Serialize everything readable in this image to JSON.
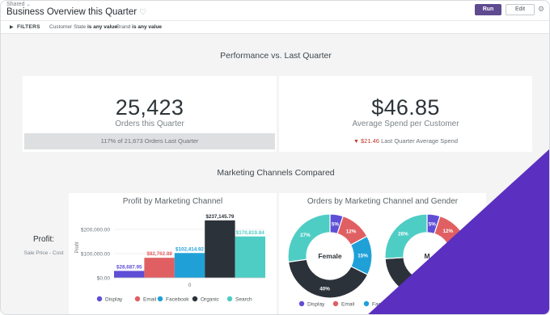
{
  "header": {
    "shared_label": "Shared",
    "title": "Business Overview this Quarter",
    "run_label": "Run",
    "edit_label": "Edit"
  },
  "filters": {
    "label": "FILTERS",
    "items": [
      {
        "name": "Customer State",
        "text": "is any value"
      },
      {
        "name": "Brand",
        "text": "is any value"
      }
    ]
  },
  "sections": {
    "performance": "Performance vs. Last Quarter",
    "channels": "Marketing Channels Compared"
  },
  "kpis": [
    {
      "value": "25,423",
      "label": "Orders this Quarter",
      "foot_pct": "117%",
      "foot_of": "of",
      "foot_value": "21,673",
      "foot_text": "Orders Last Quarter"
    },
    {
      "value": "$46.85",
      "label": "Average Spend per Customer",
      "foot_arrow": "▼",
      "foot_value": "$21.46",
      "foot_text": "Last Quarter Average Spend"
    }
  ],
  "side_label": {
    "title": "Profit:",
    "subtitle": "Sale Price - Cost"
  },
  "colors": {
    "Display": "#5e4fd6",
    "Email": "#e05f62",
    "Facebook": "#1fa1d8",
    "Organic": "#2c323a",
    "Search": "#4ecdc4"
  },
  "chart_data": [
    {
      "type": "bar",
      "title": "Profit by Marketing Channel",
      "ylabel": "Profit",
      "xlabel": "",
      "categories": [
        "0"
      ],
      "ylim": [
        0,
        250000
      ],
      "yticks": [
        "$0.00",
        "$100,000.00",
        "$200,000.00"
      ],
      "ytick_values": [
        0,
        100000,
        200000
      ],
      "series": [
        {
          "name": "Display",
          "values": [
            28687.95
          ],
          "label": "$28,687.95"
        },
        {
          "name": "Email",
          "values": [
            82762.88
          ],
          "label": "$82,762.88"
        },
        {
          "name": "Facebook",
          "values": [
            102414.92
          ],
          "label": "$102,414.92"
        },
        {
          "name": "Organic",
          "values": [
            237145.79
          ],
          "label": "$237,145.79"
        },
        {
          "name": "Search",
          "values": [
            170819.84
          ],
          "label": "$170,819.84"
        }
      ],
      "legend": [
        "Display",
        "Email",
        "Facebook",
        "Organic",
        "Search"
      ]
    },
    {
      "type": "pie",
      "title": "Orders by Marketing Channel and Gender",
      "donuts": [
        {
          "center_label": "Female",
          "slices": [
            {
              "name": "Display",
              "value": 5,
              "label": "5%"
            },
            {
              "name": "Email",
              "value": 12,
              "label": "12%"
            },
            {
              "name": "Facebook",
              "value": 15,
              "label": "15%"
            },
            {
              "name": "Organic",
              "value": 40,
              "label": "40%"
            },
            {
              "name": "Search",
              "value": 27,
              "label": "27%"
            }
          ]
        },
        {
          "center_label": "M",
          "slices": [
            {
              "name": "Display",
              "value": 5,
              "label": "5%"
            },
            {
              "name": "Email",
              "value": 12,
              "label": "12%"
            },
            {
              "name": "Facebook",
              "value": 15,
              "label": ""
            },
            {
              "name": "Organic",
              "value": 42,
              "label": ""
            },
            {
              "name": "Search",
              "value": 26,
              "label": "26%"
            }
          ]
        }
      ],
      "legend": [
        "Display",
        "Email",
        "Fac"
      ]
    }
  ]
}
